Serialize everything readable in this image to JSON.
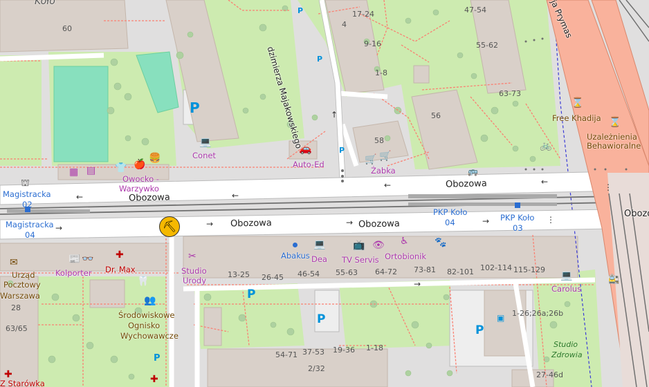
{
  "map": {
    "streets": [
      {
        "id": "obozowa-north-1",
        "text": "Obozowa"
      },
      {
        "id": "obozowa-north-2",
        "text": "Obozowa"
      },
      {
        "id": "obozowa-south-1",
        "text": "Obozowa"
      },
      {
        "id": "obozowa-south-2",
        "text": "Obozowa"
      },
      {
        "id": "obozowa-east",
        "text": "Obozowa"
      },
      {
        "id": "majakowskiego",
        "text": "dzimierza Majakowskiego"
      },
      {
        "id": "prymas",
        "text": "ja Prymas"
      }
    ],
    "house_numbers": [
      {
        "id": "hn-60",
        "text": "60"
      },
      {
        "id": "hn-4",
        "text": "4"
      },
      {
        "id": "hn-17-24",
        "text": "17-24"
      },
      {
        "id": "hn-9-16",
        "text": "9-16"
      },
      {
        "id": "hn-1-8",
        "text": "1-8"
      },
      {
        "id": "hn-47-54",
        "text": "47-54"
      },
      {
        "id": "hn-55-62",
        "text": "55-62"
      },
      {
        "id": "hn-63-73",
        "text": "63-73"
      },
      {
        "id": "hn-56",
        "text": "56"
      },
      {
        "id": "hn-58",
        "text": "58"
      },
      {
        "id": "hn-13-25",
        "text": "13-25"
      },
      {
        "id": "hn-26-45",
        "text": "26-45"
      },
      {
        "id": "hn-46-54",
        "text": "46-54"
      },
      {
        "id": "hn-55-63",
        "text": "55-63"
      },
      {
        "id": "hn-64-72",
        "text": "64-72"
      },
      {
        "id": "hn-73-81",
        "text": "73-81"
      },
      {
        "id": "hn-82-101",
        "text": "82-101"
      },
      {
        "id": "hn-102-114",
        "text": "102-114"
      },
      {
        "id": "hn-115-129",
        "text": "115-129"
      },
      {
        "id": "hn-1-26",
        "text": "1-26;26a;26b"
      },
      {
        "id": "hn-54-71",
        "text": "54-71"
      },
      {
        "id": "hn-37-53",
        "text": "37-53"
      },
      {
        "id": "hn-19-36",
        "text": "19-36"
      },
      {
        "id": "hn-1-18",
        "text": "1-18"
      },
      {
        "id": "hn-2-32",
        "text": "2/32"
      },
      {
        "id": "hn-27-46d",
        "text": "27-46d"
      },
      {
        "id": "hn-28",
        "text": "28"
      },
      {
        "id": "hn-63-65",
        "text": "63/65"
      }
    ],
    "pois": [
      {
        "id": "kolo",
        "text": "Koło"
      },
      {
        "id": "conet",
        "text": "Conet"
      },
      {
        "id": "auto-ed",
        "text": "Auto-Ed"
      },
      {
        "id": "zabka",
        "text": "Żabka"
      },
      {
        "id": "owocko-1",
        "text": "Owocko -"
      },
      {
        "id": "owocko-2",
        "text": "Warzywko"
      },
      {
        "id": "free-khadija",
        "text": "Free Khadija"
      },
      {
        "id": "uzaleznienia-1",
        "text": "Uzależnienia"
      },
      {
        "id": "uzaleznienia-2",
        "text": "Behawioralne"
      },
      {
        "id": "abakus",
        "text": "Abakus"
      },
      {
        "id": "dea",
        "text": "Dea"
      },
      {
        "id": "tv-servis",
        "text": "TV Servis"
      },
      {
        "id": "ortobionik",
        "text": "Ortobionik"
      },
      {
        "id": "studio-urody-1",
        "text": "Studio"
      },
      {
        "id": "studio-urody-2",
        "text": "Urody"
      },
      {
        "id": "kolporter",
        "text": "Kolporter"
      },
      {
        "id": "dr-max",
        "text": "Dr. Max"
      },
      {
        "id": "urzad-1",
        "text": "Urząd"
      },
      {
        "id": "urzad-2",
        "text": "Pocztowy"
      },
      {
        "id": "urzad-3",
        "text": "Warszawa"
      },
      {
        "id": "srodowiskowe-1",
        "text": "Środowiskowe"
      },
      {
        "id": "srodowiskowe-2",
        "text": "Ognisko"
      },
      {
        "id": "srodowiskowe-3",
        "text": "Wychowawcze"
      },
      {
        "id": "carolus",
        "text": "Carolus"
      },
      {
        "id": "studio-zdrowia-1",
        "text": "Studio"
      },
      {
        "id": "studio-zdrowia-2",
        "text": "Zdrowia"
      },
      {
        "id": "starowka",
        "text": "Z Starówka"
      }
    ],
    "transit": [
      {
        "id": "magistracka-02-a",
        "text": "Magistracka"
      },
      {
        "id": "magistracka-02-b",
        "text": "02"
      },
      {
        "id": "magistracka-04-a",
        "text": "Magistracka"
      },
      {
        "id": "magistracka-04-b",
        "text": "04"
      },
      {
        "id": "pkp-kolo-04-a",
        "text": "PKP Koło"
      },
      {
        "id": "pkp-kolo-04-b",
        "text": "04"
      },
      {
        "id": "pkp-kolo-03-a",
        "text": "PKP Koło"
      },
      {
        "id": "pkp-kolo-03-b",
        "text": "03"
      }
    ],
    "parking_symbol": "P",
    "colors": {
      "background": "#f2efe9",
      "residential": "#e0dfdf",
      "building": "#d9d0c9",
      "park": "#c8facc",
      "grass": "#cdebb0",
      "pitch": "#88e0be",
      "road": "#ffffff",
      "trunk": "#f9b29c",
      "rail": "#707070",
      "footway": "#fa8072",
      "tree": "#aed1a0",
      "shop_purple": "#ac39ac",
      "transit_blue": "#2a6dd1",
      "health_red": "#bf0000"
    }
  }
}
